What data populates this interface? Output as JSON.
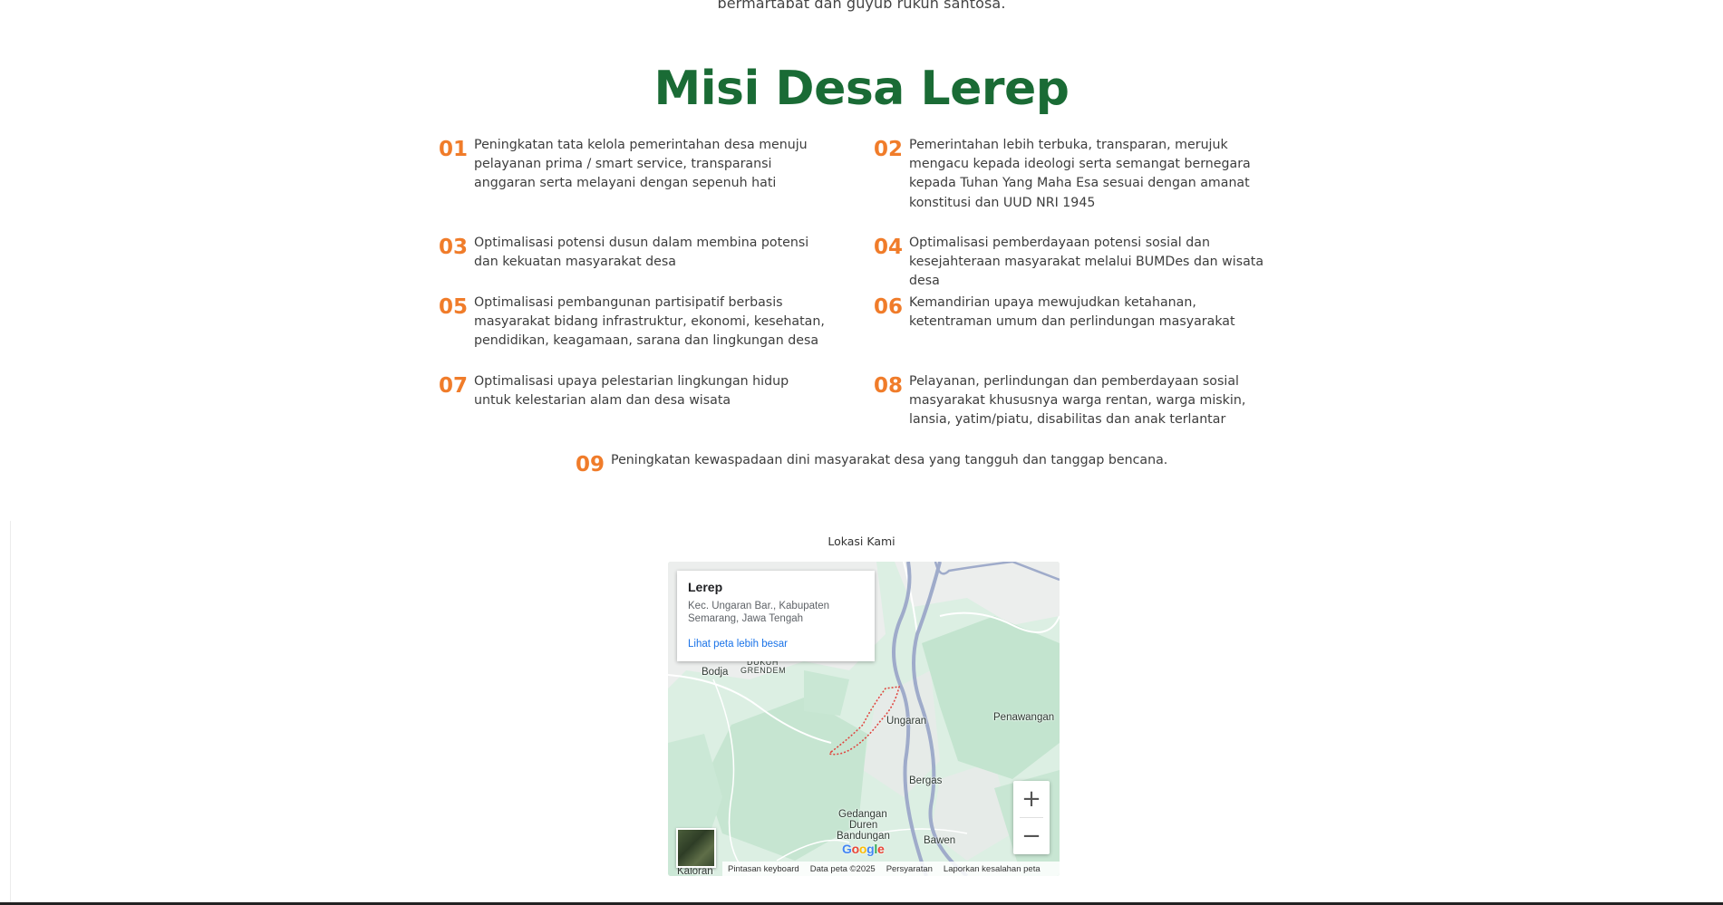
{
  "intro_tail": "bermartabat dan guyub rukun santosa.",
  "misi": {
    "title": "Misi Desa Lerep",
    "items": [
      {
        "num": "01",
        "text": "Peningkatan tata kelola pemerintahan desa menuju pelayanan prima / smart service, transparansi anggaran serta melayani dengan sepenuh hati"
      },
      {
        "num": "02",
        "text": "Pemerintahan lebih terbuka, transparan, merujuk mengacu kepada ideologi serta semangat bernegara kepada Tuhan Yang Maha Esa sesuai dengan amanat konstitusi dan UUD NRI 1945"
      },
      {
        "num": "03",
        "text": "Optimalisasi potensi dusun dalam membina potensi dan kekuatan masyarakat desa"
      },
      {
        "num": "04",
        "text": "Optimalisasi pemberdayaan potensi sosial dan kesejahteraan masyarakat melalui BUMDes dan wisata desa"
      },
      {
        "num": "05",
        "text": "Optimalisasi pembangunan partisipatif berbasis masyarakat bidang infrastruktur, ekonomi, kesehatan, pendidikan, keagamaan, sarana dan lingkungan desa"
      },
      {
        "num": "06",
        "text": "Kemandirian upaya mewujudkan ketahanan, ketentraman umum dan perlindungan masyarakat"
      },
      {
        "num": "07",
        "text": "Optimalisasi upaya pelestarian lingkungan hidup untuk kelestarian alam dan desa wisata"
      },
      {
        "num": "08",
        "text": "Pelayanan, perlindungan dan pemberdayaan sosial masyarakat khususnya warga rentan, warga miskin, lansia, yatim/piatu, disabilitas dan anak terlantar"
      },
      {
        "num": "09",
        "text": "Peningkatan kewaspadaan dini masyarakat desa yang tangguh dan tanggap bencana."
      }
    ]
  },
  "location": {
    "label": "Lokasi Kami",
    "card": {
      "name": "Lerep",
      "address": "Kec. Ungaran Bar., Kabupaten Semarang, Jawa Tengah",
      "link": "Lihat peta lebih besar"
    },
    "places": {
      "dukuh": "DUKUH",
      "grendem": "GRENDEM",
      "bodja": "Bodja",
      "ungaran": "Ungaran",
      "penawangan": "Penawangan",
      "bergas": "Bergas",
      "gedangan": "Gedangan",
      "duren": "Duren",
      "bandungan": "Bandungan",
      "bawen": "Bawen",
      "kaloran": "Kaloran"
    },
    "zoom_in": "+",
    "zoom_out": "−",
    "logo": "Google",
    "attribution": [
      "Pintasan keyboard",
      "Data peta ©2025",
      "Persyaratan",
      "Laporkan kesalahan peta"
    ],
    "colors": {
      "land": "#ddeee3",
      "forest": "#bfe1cc",
      "road": "#9aa8c6",
      "boundary": "#e0403a"
    }
  }
}
